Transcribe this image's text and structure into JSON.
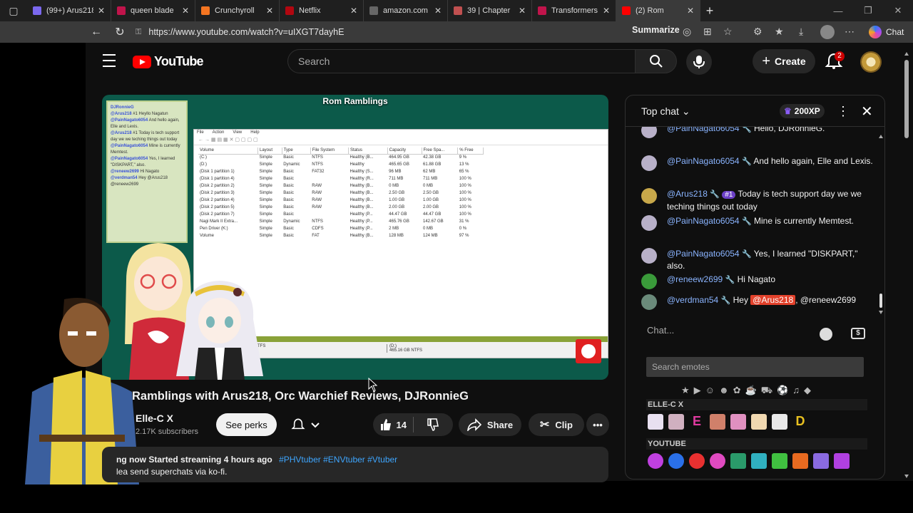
{
  "browser": {
    "tabs": [
      {
        "title": "(99+) Arus218",
        "color": "#7b68ee"
      },
      {
        "title": "queen blade",
        "color": "#c0144b"
      },
      {
        "title": "Crunchyroll",
        "color": "#f47521"
      },
      {
        "title": "Netflix",
        "color": "#b20710"
      },
      {
        "title": "amazon.com",
        "color": "#666666"
      },
      {
        "title": "39 | Chapter",
        "color": "#c05050"
      },
      {
        "title": "Transformers",
        "color": "#c0144b"
      },
      {
        "title": "(2) Rom",
        "color": "#ff0000"
      }
    ],
    "new_tab": "+",
    "url": "https://www.youtube.com/watch?v=uIXGT7dayhE",
    "summarize": "Summarize",
    "chat_label": "Chat"
  },
  "youtube": {
    "logo_text": "YouTube",
    "search_placeholder": "Search",
    "create_label": "Create",
    "notif_count": "2"
  },
  "stream": {
    "overlay_title": "Rom Ramblings",
    "overlay_chat": [
      {
        "user": "DJRonnieG",
        "text": ""
      },
      {
        "user": "@Arus218",
        "text": "#1 Heyllo Nagatun"
      },
      {
        "user": "@PainNagato6054",
        "text": "And hello again, Elle and Lexis."
      },
      {
        "user": "@Arus218",
        "text": "#1 Today is tech support day we we teching things out today"
      },
      {
        "user": "@PainNagato6054",
        "text": "Mine is currently Memtest."
      },
      {
        "user": "@PainNagato6054",
        "text": "Yes, I learned \"DISKPART,\" also."
      },
      {
        "user": "@reneew2699",
        "text": "Hi Nagato"
      },
      {
        "user": "@verdman54",
        "text": "Hey @Arus218 @reneew2699"
      }
    ],
    "disk_menu": [
      "File",
      "Action",
      "View",
      "Help"
    ],
    "disk_headers": [
      "Volume",
      "Layout",
      "Type",
      "File System",
      "Status",
      "Capacity",
      "Free Spa...",
      "% Free"
    ],
    "disk_rows": [
      [
        "(C:)",
        "Simple",
        "Basic",
        "NTFS",
        "Healthy (B...",
        "464.95 GB",
        "42.38 GB",
        "9 %"
      ],
      [
        "(D:)",
        "Simple",
        "Dynamic",
        "NTFS",
        "Healthy",
        "465.65 GB",
        "61.88 GB",
        "13 %"
      ],
      [
        "(Disk 1 partition 1)",
        "Simple",
        "Basic",
        "FAT32",
        "Healthy (S...",
        "96 MB",
        "62 MB",
        "65 %"
      ],
      [
        "(Disk 1 partition 4)",
        "Simple",
        "Basic",
        "",
        "Healthy (R...",
        "711 MB",
        "711 MB",
        "100 %"
      ],
      [
        "(Disk 2 partition 2)",
        "Simple",
        "Basic",
        "RAW",
        "Healthy (B...",
        "0 MB",
        "0 MB",
        "100 %"
      ],
      [
        "(Disk 2 partition 3)",
        "Simple",
        "Basic",
        "RAW",
        "Healthy (B...",
        "2.50 GB",
        "2.50 GB",
        "100 %"
      ],
      [
        "(Disk 2 partition 4)",
        "Simple",
        "Basic",
        "RAW",
        "Healthy (B...",
        "1.00 GB",
        "1.00 GB",
        "100 %"
      ],
      [
        "(Disk 2 partition 5)",
        "Simple",
        "Basic",
        "RAW",
        "Healthy (B...",
        "2.00 GB",
        "2.00 GB",
        "100 %"
      ],
      [
        "(Disk 2 partition 7)",
        "Simple",
        "Basic",
        "",
        "Healthy (P...",
        "44.47 GB",
        "44.47 GB",
        "100 %"
      ],
      [
        "Nagi Mark II Extra...",
        "Simple",
        "Dynamic",
        "NTFS",
        "Healthy (P...",
        "465.76 GB",
        "142.67 GB",
        "31 %"
      ],
      [
        "Pen Driver (K:)",
        "Simple",
        "Basic",
        "CDFS",
        "Healthy (P...",
        "2 MB",
        "0 MB",
        "0 %"
      ],
      [
        "Volume",
        "Simple",
        "Basic",
        "FAT",
        "Healthy (B...",
        "128 MB",
        "124 MB",
        "97 %"
      ]
    ],
    "disk_bottom_1": "MB NTFS",
    "disk_bottom_2_label": "(D:)",
    "disk_bottom_2_size": "465.16 GB NTFS"
  },
  "video": {
    "title": "Ramblings with Arus218, Orc Warchief Reviews, DJRonnieG",
    "channel": "Elle-C X",
    "subscribers": "2.17K subscribers",
    "see_perks": "See perks",
    "likes": "14",
    "share": "Share",
    "clip": "Clip",
    "desc_status": "ng now",
    "desc_started": "Started streaming 4 hours ago",
    "desc_tags": "#PHVtuber #ENVtuber #Vtuber",
    "desc_line2": "lea  send superchats via ko-fi."
  },
  "chat": {
    "mode": "Top chat",
    "xp": "200XP",
    "messages": [
      {
        "author": "@PainNagato6054",
        "text": "Hello, DJRonnieG.",
        "avatar": "#b8b0c8"
      },
      {
        "author": "@PainNagato6054",
        "text": "And hello again, Elle and Lexis.",
        "avatar": "#b8b0c8"
      },
      {
        "author": "@Arus218",
        "rank": "#1",
        "text": "Today is tech support day we we teching things out today",
        "avatar": "#c8a84a"
      },
      {
        "author": "@PainNagato6054",
        "text": "Mine is currently Memtest.",
        "avatar": "#b8b0c8"
      },
      {
        "author": "@PainNagato6054",
        "text": "Yes, I learned \"DISKPART,\" also.",
        "avatar": "#b8b0c8"
      },
      {
        "author": "@reneew2699",
        "text": "Hi Nagato",
        "avatar": "#3a9a3a"
      },
      {
        "author": "@verdman54",
        "mention": "@Arus218",
        "text_after": ", @reneew2699",
        "text_before": "Hey",
        "avatar": "#6a8a7a"
      }
    ],
    "input_placeholder": "Chat...",
    "emote_search_placeholder": "Search emotes",
    "section_1": "ELLE-C X",
    "section_2": "YOUTUBE"
  }
}
